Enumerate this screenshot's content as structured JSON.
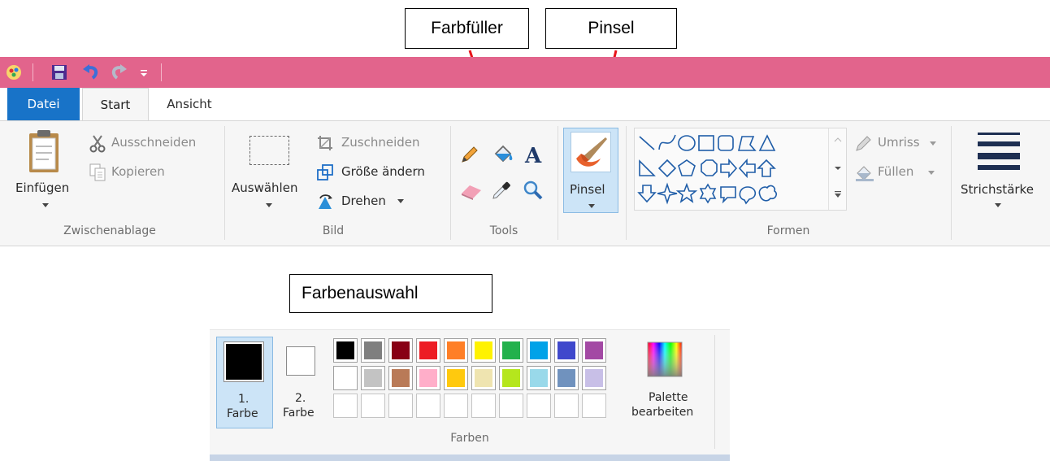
{
  "callouts": {
    "farbfueller": "Farbfüller",
    "pinsel": "Pinsel",
    "farbenauswahl": "Farbenauswahl"
  },
  "tabs": {
    "file": "Datei",
    "start": "Start",
    "view": "Ansicht"
  },
  "clipboard": {
    "paste": "Einfügen",
    "cut": "Ausschneiden",
    "copy": "Kopieren",
    "group": "Zwischenablage"
  },
  "image": {
    "select": "Auswählen",
    "crop": "Zuschneiden",
    "resize": "Größe ändern",
    "rotate": "Drehen",
    "group": "Bild"
  },
  "tools": {
    "group": "Tools"
  },
  "brushes": {
    "label": "Pinsel"
  },
  "shapes": {
    "outline": "Umriss",
    "fill": "Füllen",
    "group": "Formen"
  },
  "size": {
    "label": "Strichstärke"
  },
  "colors": {
    "color1_line1": "1.",
    "color1_line2": "Farbe",
    "color2_line1": "2.",
    "color2_line2": "Farbe",
    "edit_line1": "Palette",
    "edit_line2": "bearbeiten",
    "group": "Farben",
    "row1": [
      "#000000",
      "#7f7f7f",
      "#880015",
      "#ed1c24",
      "#ff7f27",
      "#fff200",
      "#22b14c",
      "#00a2e8",
      "#3f48cc",
      "#a349a4"
    ],
    "row2": [
      "#ffffff",
      "#c3c3c3",
      "#b97a57",
      "#ffaec9",
      "#ffc90e",
      "#efe4b0",
      "#b5e61d",
      "#99d9ea",
      "#7092be",
      "#c8bfe7"
    ]
  }
}
